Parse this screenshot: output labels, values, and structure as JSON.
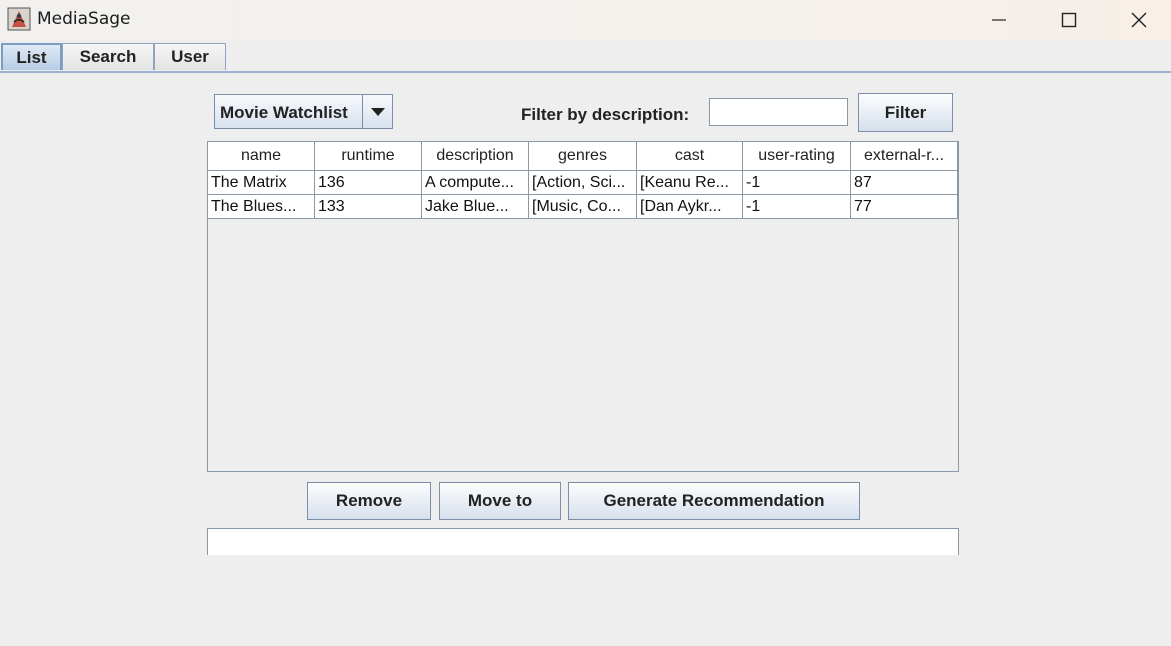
{
  "window": {
    "title": "MediaSage"
  },
  "tabs": [
    {
      "label": "List"
    },
    {
      "label": "Search"
    },
    {
      "label": "User"
    }
  ],
  "list_selector": {
    "value": "Movie Watchlist"
  },
  "filter": {
    "label": "Filter by description:",
    "value": "",
    "button_label": "Filter"
  },
  "table": {
    "columns": [
      "name",
      "runtime",
      "description",
      "genres",
      "cast",
      "user-rating",
      "external-r..."
    ],
    "rows": [
      [
        "The Matrix",
        "136",
        "A compute...",
        "[Action, Sci...",
        "[Keanu Re...",
        "-1",
        "87"
      ],
      [
        "The Blues...",
        "133",
        "Jake Blue...",
        "[Music, Co...",
        "[Dan Aykr...",
        "-1",
        "77"
      ]
    ]
  },
  "actions": {
    "remove": "Remove",
    "move_to": "Move to",
    "generate": "Generate Recommendation"
  },
  "output": {
    "text": ""
  }
}
